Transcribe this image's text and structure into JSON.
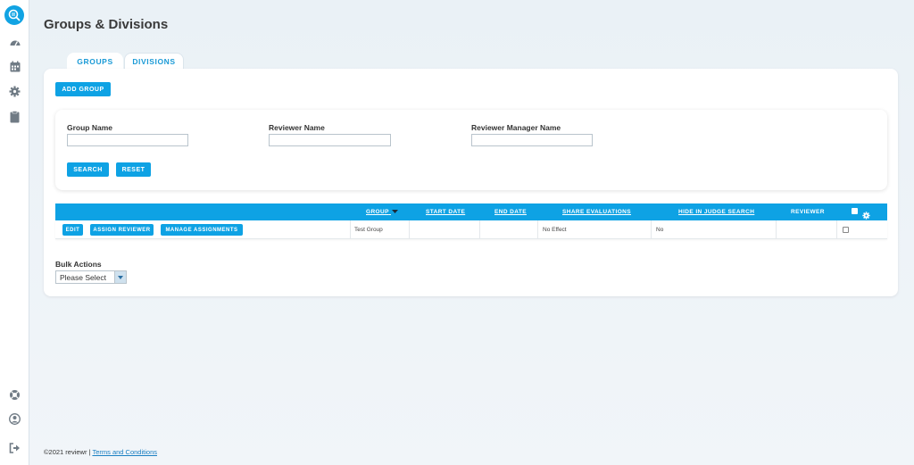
{
  "page": {
    "title": "Groups & Divisions"
  },
  "sidebar": {
    "items": [
      {
        "icon": "speedometer-icon"
      },
      {
        "icon": "calendar-icon"
      },
      {
        "icon": "gear-icon"
      },
      {
        "icon": "clipboard-icon"
      }
    ],
    "bottom_items": [
      {
        "icon": "lifebuoy-icon"
      },
      {
        "icon": "user-icon"
      },
      {
        "icon": "logout-icon"
      }
    ]
  },
  "tabs": [
    {
      "label": "GROUPS",
      "active": true
    },
    {
      "label": "DIVISIONS",
      "active": false
    }
  ],
  "toolbar": {
    "add_group_label": "ADD GROUP"
  },
  "filters": {
    "group_name_label": "Group Name",
    "group_name_value": "",
    "reviewer_name_label": "Reviewer Name",
    "reviewer_name_value": "",
    "reviewer_manager_label": "Reviewer Manager Name",
    "reviewer_manager_value": "",
    "search_label": "SEARCH",
    "reset_label": "RESET"
  },
  "table": {
    "columns": {
      "group": "GROUP",
      "start_date": "START DATE",
      "end_date": "END DATE",
      "share_evaluations": "SHARE EVALUATIONS",
      "hide_in_judge_search": "HIDE IN JUDGE SEARCH",
      "reviewer": "REVIEWER"
    },
    "rows": [
      {
        "actions": {
          "edit": "EDIT",
          "assign_reviewer": "ASSIGN REVIEWER",
          "manage_assignments": "MANAGE ASSIGNMENTS"
        },
        "group": "Test Group",
        "start_date": "",
        "end_date": "",
        "share_evaluations": "No Effect",
        "hide_in_judge_search": "No",
        "reviewer": ""
      }
    ]
  },
  "bulk_actions": {
    "label": "Bulk Actions",
    "selected": "Please Select"
  },
  "footer": {
    "copyright": "©2021 reviewr |",
    "link": "Terms and Conditions"
  },
  "colors": {
    "accent": "#0ea2e4",
    "background": "#eaf1f6"
  }
}
